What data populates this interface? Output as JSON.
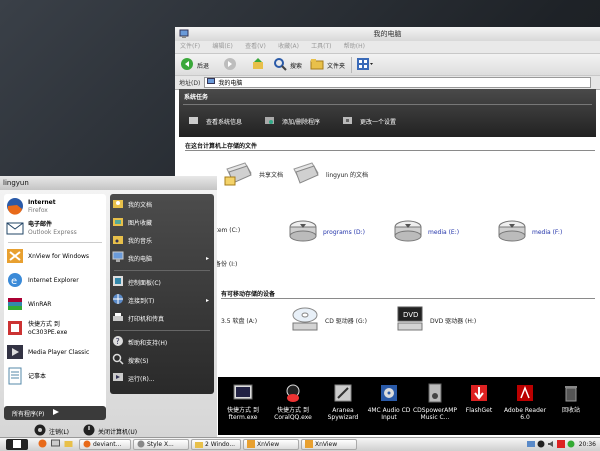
{
  "explorer": {
    "title": "我的电脑",
    "menu": [
      "文件(F)",
      "编辑(E)",
      "查看(V)",
      "收藏(A)",
      "工具(T)",
      "帮助(H)"
    ],
    "toolbar": {
      "back": "后退",
      "search": "搜索",
      "folders": "文件夹"
    },
    "address_label": "地址(D)",
    "address_value": "我的电脑",
    "system_tasks": {
      "title": "系统任务",
      "items": [
        "查看系统信息",
        "添加/删除程序",
        "更改一个设置"
      ]
    },
    "section_files": "在这台计算机上存储的文件",
    "files": [
      "共享文档",
      "lingyun 的文档"
    ],
    "drives": [
      "System (C:)",
      "programs (D:)",
      "media (E:)",
      "media (F:)"
    ],
    "backup": "硬盘备份 (I:)",
    "section_removable": "有可移动存储的设备",
    "removable": [
      "3.5 软盘 (A:)",
      "CD 驱动器 (G:)",
      "DVD 驱动器 (H:)"
    ]
  },
  "start_menu": {
    "user": "lingyun",
    "pinned": [
      {
        "title": "Internet",
        "sub": "Firefox",
        "icon": "firefox-icon"
      },
      {
        "title": "电子邮件",
        "sub": "Outlook Express",
        "icon": "mail-icon"
      }
    ],
    "recent": [
      {
        "label": "XnView for Windows",
        "icon": "xnview-icon"
      },
      {
        "label": "Internet Explorer",
        "icon": "ie-icon"
      },
      {
        "label": "WinRAR",
        "icon": "winrar-icon"
      },
      {
        "label": "快捷方式 到\noC303PE.exe",
        "icon": "shortcut-icon"
      },
      {
        "label": "Media Player Classic",
        "icon": "media-player-icon"
      },
      {
        "label": "记事本",
        "icon": "notepad-icon"
      }
    ],
    "all_programs": "所有程序(P)",
    "right": [
      {
        "label": "我的文档",
        "icon": "documents-folder-icon"
      },
      {
        "label": "图片收藏",
        "icon": "pictures-folder-icon"
      },
      {
        "label": "我的音乐",
        "icon": "music-folder-icon"
      },
      {
        "label": "我的电脑",
        "icon": "computer-icon"
      },
      {
        "label": "控制面板(C)",
        "icon": "control-panel-icon"
      },
      {
        "label": "连接到(T)",
        "icon": "network-icon"
      },
      {
        "label": "打印机和传真",
        "icon": "printer-icon"
      },
      {
        "label": "帮助和支持(H)",
        "icon": "help-icon"
      },
      {
        "label": "搜索(S)",
        "icon": "search-icon"
      },
      {
        "label": "运行(R)...",
        "icon": "run-icon"
      }
    ],
    "logoff": "注销(L)",
    "shutdown": "关闭计算机(U)"
  },
  "dock": [
    {
      "label": "快捷方式 到\nfterm.exe",
      "icon": "fterm-icon"
    },
    {
      "label": "快捷方式 到\nCoralQQ.exe",
      "icon": "coralqq-icon"
    },
    {
      "label": "Aranea\nSpywizard",
      "icon": "spywizard-icon"
    },
    {
      "label": "4MC Audio CD\nInput",
      "icon": "audio-cd-icon"
    },
    {
      "label": "CDSpowerAMP\nMusic C...",
      "icon": "poweramp-icon"
    },
    {
      "label": "FlashGet",
      "icon": "flashget-icon"
    },
    {
      "label": "Adobe Reader\n6.0",
      "icon": "adobe-reader-icon"
    },
    {
      "label": "回收站",
      "icon": "recycle-bin-icon"
    }
  ],
  "taskbar": {
    "items": [
      "deviant...",
      "Style X...",
      "2 Windo...",
      "XnView",
      "XnView"
    ],
    "clock": "20:36"
  }
}
